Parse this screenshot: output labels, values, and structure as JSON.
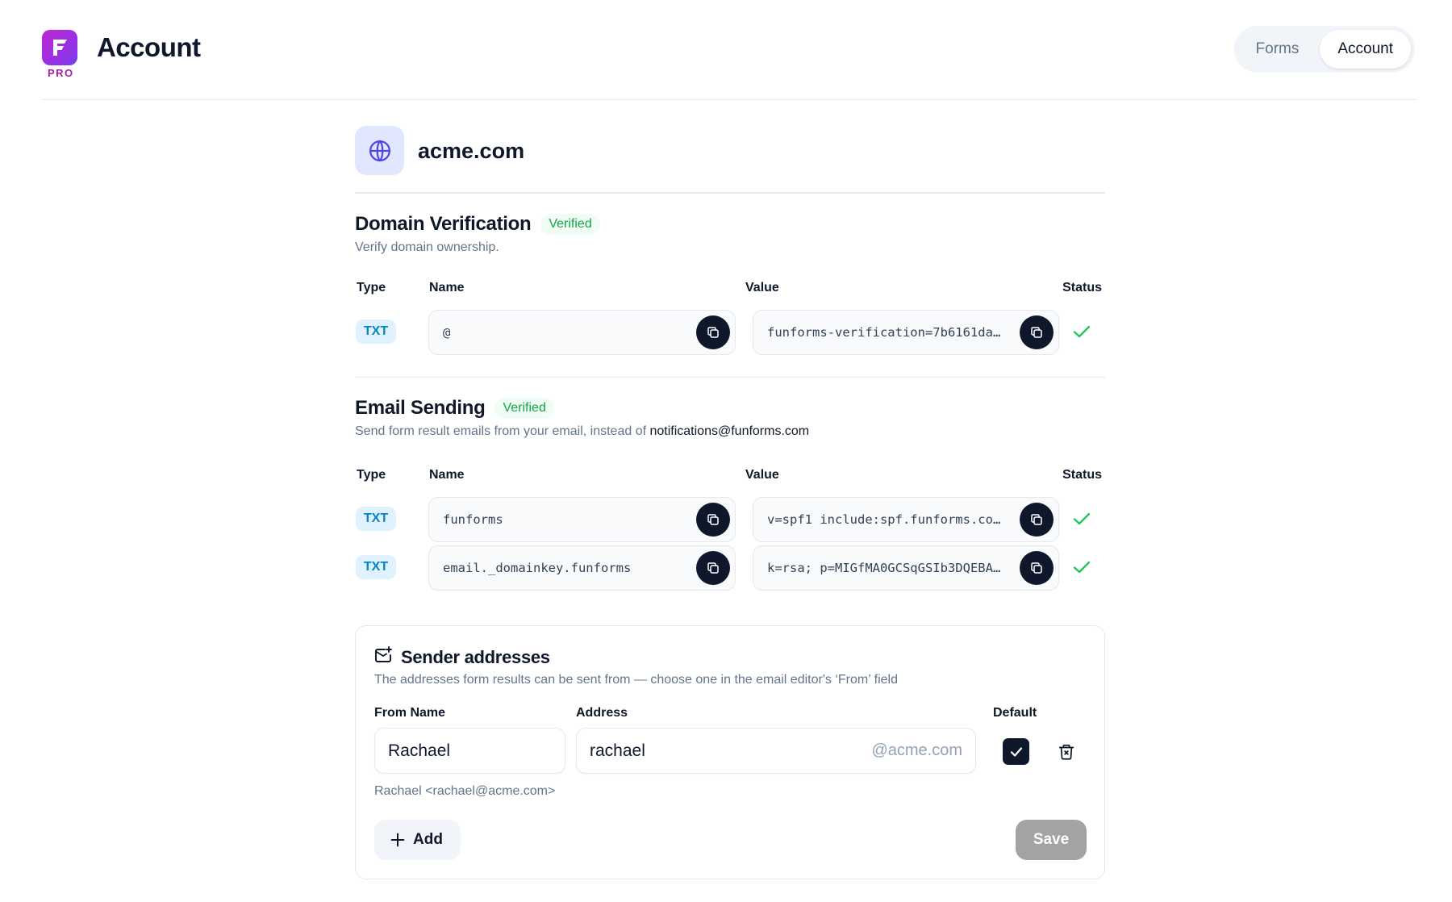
{
  "header": {
    "logo_badge": "PRO",
    "title": "Account",
    "nav": [
      {
        "label": "Forms",
        "active": false
      },
      {
        "label": "Account",
        "active": true
      }
    ]
  },
  "domain": {
    "icon": "globe-icon",
    "name": "acme.com"
  },
  "domain_verification": {
    "title": "Domain Verification",
    "badge": "Verified",
    "description": "Verify domain ownership.",
    "columns": {
      "type": "Type",
      "name": "Name",
      "value": "Value",
      "status": "Status"
    },
    "records": [
      {
        "type": "TXT",
        "name": "@",
        "value": "funforms-verification=7b6161da…",
        "status": "verified"
      }
    ]
  },
  "email_sending": {
    "title": "Email Sending",
    "badge": "Verified",
    "description_prefix": "Send form result emails from your email, instead of ",
    "description_email": "notifications@funforms.com",
    "columns": {
      "type": "Type",
      "name": "Name",
      "value": "Value",
      "status": "Status"
    },
    "records": [
      {
        "type": "TXT",
        "name": "funforms",
        "value": "v=spf1 include:spf.funforms.co…",
        "status": "verified"
      },
      {
        "type": "TXT",
        "name": "email._domainkey.funforms",
        "value": "k=rsa; p=MIGfMA0GCSqGSIb3DQEBA…",
        "status": "verified"
      }
    ]
  },
  "sender_addresses": {
    "title": "Sender addresses",
    "icon": "mail-check-icon",
    "description": "The addresses form results can be sent from — choose one in the email editor's ‘From’ field",
    "labels": {
      "from_name": "From Name",
      "address": "Address",
      "default": "Default"
    },
    "entry": {
      "from_name": "Rachael",
      "address": "rachael",
      "domain_suffix": "@acme.com",
      "is_default": true,
      "preview": "Rachael <rachael@acme.com>"
    },
    "add_label": "Add",
    "save_label": "Save"
  },
  "colors": {
    "accent": "#0f172a",
    "verified": "#16a34a",
    "check": "#22c55e",
    "chip_text": "#0284c7",
    "save_disabled": "#a3a3a3",
    "logo_gradient_start": "#c026d3",
    "logo_gradient_end": "#7c3aed"
  }
}
